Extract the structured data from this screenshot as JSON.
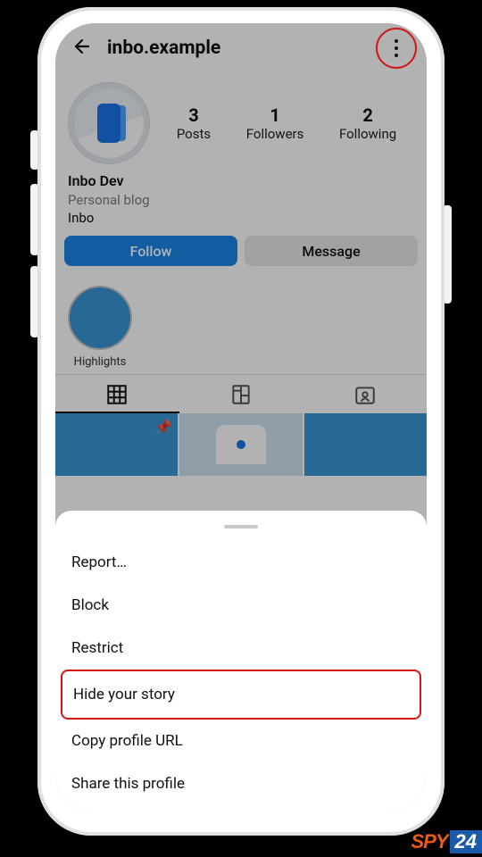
{
  "header": {
    "username": "inbo.example"
  },
  "profile": {
    "stats": {
      "posts_count": "3",
      "posts_label": "Posts",
      "followers_count": "1",
      "followers_label": "Followers",
      "following_count": "2",
      "following_label": "Following"
    },
    "display_name": "Inbo Dev",
    "category": "Personal blog",
    "bio_text": "Inbo"
  },
  "actions": {
    "follow_label": "Follow",
    "message_label": "Message"
  },
  "highlights": {
    "label": "Highlights"
  },
  "icons": {
    "back": "back-arrow-icon",
    "kebab": "more-options-icon",
    "grid_tab": "grid-icon",
    "reels_tab": "reels-guide-icon",
    "tagged_tab": "tagged-person-icon",
    "pin": "pin-icon"
  },
  "sheet": {
    "items": [
      {
        "label": "Report…",
        "highlight": false
      },
      {
        "label": "Block",
        "highlight": false
      },
      {
        "label": "Restrict",
        "highlight": false
      },
      {
        "label": "Hide your story",
        "highlight": true
      },
      {
        "label": "Copy profile URL",
        "highlight": false
      },
      {
        "label": "Share this profile",
        "highlight": false
      }
    ]
  },
  "watermark": {
    "part1": "SPY",
    "part2": "24"
  },
  "colors": {
    "primary_blue": "#1a84e8",
    "highlight_red": "#d31818",
    "avatar_blue": "#3a95d6"
  }
}
